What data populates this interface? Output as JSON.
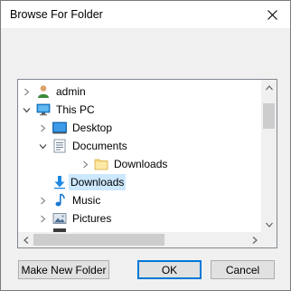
{
  "window": {
    "title": "Browse For Folder"
  },
  "tree": {
    "items": [
      {
        "label": "admin",
        "icon": "user-icon",
        "expand": "collapsed"
      },
      {
        "label": "This PC",
        "icon": "computer-icon",
        "expand": "expanded"
      },
      {
        "label": "Desktop",
        "icon": "desktop-folder-icon",
        "expand": "collapsed"
      },
      {
        "label": "Documents",
        "icon": "documents-folder-icon",
        "expand": "expanded"
      },
      {
        "label": "Downloads",
        "icon": "folder-icon",
        "expand": "collapsed"
      },
      {
        "label": "Downloads",
        "icon": "downloads-folder-icon",
        "expand": "none",
        "selected": true
      },
      {
        "label": "Music",
        "icon": "music-folder-icon",
        "expand": "collapsed"
      },
      {
        "label": "Pictures",
        "icon": "pictures-folder-icon",
        "expand": "collapsed"
      }
    ]
  },
  "buttons": {
    "new_folder": "Make New Folder",
    "ok": "OK",
    "cancel": "Cancel"
  },
  "colors": {
    "selection": "#cce8ff",
    "default_button_border": "#0078d7"
  }
}
